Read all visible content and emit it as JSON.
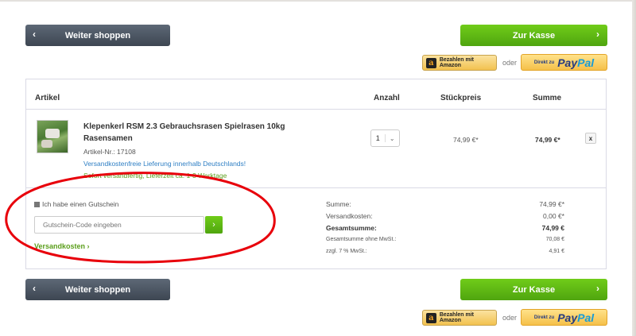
{
  "top_actions": {
    "continue_label": "Weiter shoppen",
    "checkout_label": "Zur Kasse",
    "amazon_label": "Bezahlen mit Amazon",
    "oder": "oder",
    "paypal_small": "Direkt zu",
    "paypal_pay": "Pay",
    "paypal_pal": "Pal"
  },
  "bottom_actions": {
    "continue_label": "Weiter shoppen",
    "checkout_label": "Zur Kasse",
    "amazon_label": "Bezahlen mit Amazon",
    "oder": "oder",
    "paypal_small": "Direkt zu",
    "paypal_pay": "Pay",
    "paypal_pal": "Pal"
  },
  "cart": {
    "columns": {
      "article": "Artikel",
      "quantity": "Anzahl",
      "unit_price": "Stückpreis",
      "total": "Summe"
    },
    "item": {
      "title": "Klepenkerl RSM 2.3 Gebrauchsrasen Spielrasen 10kg Rasensamen",
      "article_no": "Artikel-Nr.: 17108",
      "shipping_note": "Versandkostenfreie Lieferung innerhalb Deutschlands!",
      "delivery_note": "Sofort versandfertig, Lieferzeit ca. 1-3 Werktage",
      "quantity": "1",
      "unit_price": "74,99 €*",
      "total": "74,99 €*",
      "remove": "x"
    },
    "voucher": {
      "checkbox_label": "Ich habe einen Gutschein",
      "input_placeholder": "Gutschein-Code eingeben",
      "shipping_link": "Versandkosten"
    },
    "summary": [
      {
        "label": "Summe:",
        "value": "74,99 €*"
      },
      {
        "label": "Versandkosten:",
        "value": "0,00 €*"
      },
      {
        "label": "Gesamtsumme:",
        "value": "74,99 €"
      },
      {
        "label": "Gesamtsumme ohne MwSt.:",
        "value": "70,08 €"
      },
      {
        "label": "zzgl. 7 % MwSt.:",
        "value": "4,91 €"
      }
    ]
  },
  "icons": {
    "chevron_left": "‹",
    "chevron_right": "›",
    "chevron_down": "⌄",
    "amazon_logo": "a"
  },
  "colors": {
    "highlight_ellipse": "#e8000b",
    "accent_green": "#5fb914",
    "dark_button": "#4a5461"
  }
}
